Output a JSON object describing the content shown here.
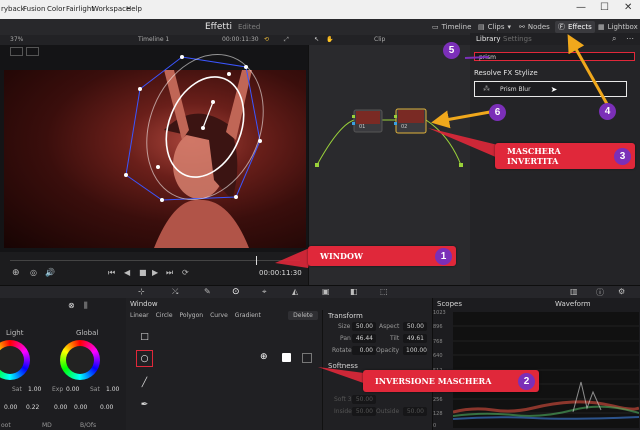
{
  "menubar": {
    "items": [
      "ryback",
      "Fusion",
      "Color",
      "Fairlight",
      "Workspace",
      "Help"
    ],
    "window_controls": [
      "—",
      "☐",
      "✕"
    ]
  },
  "toolbar": {
    "page_title": "Effetti",
    "page_status": "Edited",
    "buttons": [
      {
        "label": "Timeline"
      },
      {
        "label": "Clips"
      },
      {
        "label": "Nodes"
      },
      {
        "label": "Effects"
      },
      {
        "label": "Lightbox"
      }
    ]
  },
  "viewer": {
    "zoom": "37%",
    "timeline_name": "Timeline 1",
    "timecode_top": "00:00:11:30",
    "clip_label": "Clip",
    "timecode_bottom": "00:00:11:30"
  },
  "nodes": {
    "node1_label": "01",
    "node2_label": "02"
  },
  "library": {
    "tabs": [
      "Library",
      "Settings"
    ],
    "search_value": "prism",
    "section_title": "Resolve FX Stylize",
    "effect_item": "Prism Blur"
  },
  "annotations": {
    "badges": [
      "1",
      "2",
      "3",
      "4",
      "5",
      "6"
    ],
    "window_callout": "WINDOW",
    "invert_callout": "MASCHERA INVERTITA",
    "mask_invert_callout": "INVERSIONE MASCHERA"
  },
  "wheels": {
    "light_label": "Light",
    "global_label": "Global",
    "sat_label": "Sat",
    "sat1": "1.00",
    "sat2": "1.00",
    "exp_label": "Exp",
    "exp_value": "0.00",
    "row": [
      "0.00",
      "0.22",
      "0.00",
      "0.00",
      "0.00"
    ],
    "bottom_labels": [
      "oot",
      "MD",
      "B/Ofs"
    ]
  },
  "window_panel": {
    "title": "Window",
    "tools": [
      "Linear",
      "Circle",
      "Polygon",
      "Curve",
      "Gradient"
    ],
    "delete_label": "Delete"
  },
  "transform": {
    "title": "Transform",
    "rows": [
      {
        "l1": "Size",
        "v1": "50.00",
        "l2": "Aspect",
        "v2": "50.00"
      },
      {
        "l1": "Pan",
        "v1": "46.44",
        "l2": "Tilt",
        "v2": "49.61"
      },
      {
        "l1": "Rotate",
        "v1": "0.00",
        "l2": "Opacity",
        "v2": "100.00"
      }
    ],
    "softness_title": "Softness",
    "soft_rows": [
      {
        "l": "Soft 3",
        "v": "50.00"
      },
      {
        "l": "Inside",
        "v": "50.00",
        "l2": "Outside",
        "v2": "50.00"
      }
    ]
  },
  "scopes": {
    "title": "Scopes",
    "mode": "Waveform",
    "ticks": [
      "1023",
      "896",
      "768",
      "640",
      "512",
      "384",
      "256",
      "128",
      "0"
    ]
  },
  "colors": {
    "accent_purple": "#7b2fb8",
    "callout_red": "#e0283a",
    "arrow_yellow": "#f0a81c"
  }
}
